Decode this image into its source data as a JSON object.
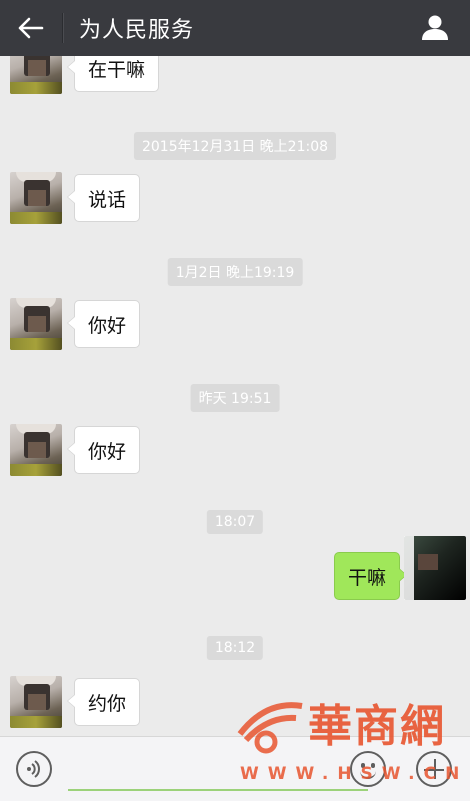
{
  "header": {
    "title": "为人民服务",
    "back_icon": "back-arrow-icon",
    "profile_icon": "person-icon"
  },
  "messages": [
    {
      "side": "left",
      "text": "在干嘛"
    },
    {
      "timestamp": "2015年12月31日 晚上21:08"
    },
    {
      "side": "left",
      "text": "说话"
    },
    {
      "timestamp": "1月2日 晚上19:19"
    },
    {
      "side": "left",
      "text": "你好"
    },
    {
      "timestamp": "昨天 19:51"
    },
    {
      "side": "left",
      "text": "你好"
    },
    {
      "timestamp": "18:07"
    },
    {
      "side": "right",
      "text": "干嘛"
    },
    {
      "timestamp": "18:12"
    },
    {
      "side": "left",
      "text": "约你"
    }
  ],
  "input_bar": {
    "voice_icon": "voice-icon",
    "emoji_icon": "emoji-icon",
    "more_icon": "plus-icon"
  },
  "watermark": {
    "text": "華商網",
    "url": "WWW.HSW.CN"
  },
  "colors": {
    "header_bg": "#393a3f",
    "chat_bg": "#ebebeb",
    "incoming_bubble": "#ffffff",
    "outgoing_bubble": "#a0e75a",
    "timestamp_bg": "#dadada",
    "watermark": "#e8552f"
  }
}
